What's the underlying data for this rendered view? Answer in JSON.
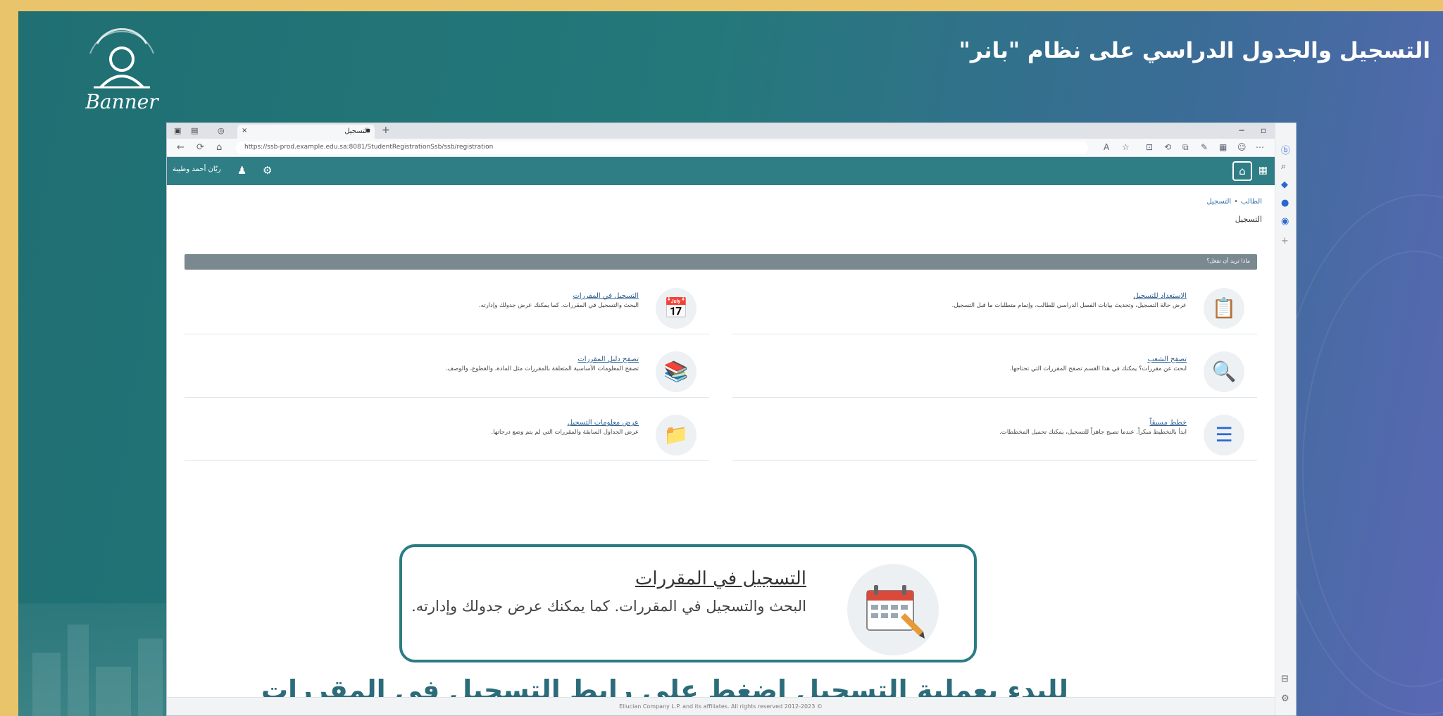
{
  "slide": {
    "title": "التسجيل والجدول الدراسي على نظام \"بانر\"",
    "logo_word": "Banner",
    "instruction": "للبدء بعملية التسجيل إضغط على رابط التسجيل في المقررات",
    "colors": {
      "frame": "#e9c46a",
      "teal": "#1f6f73",
      "accent": "#2c6c7a"
    }
  },
  "browser": {
    "tab_title": "التسجيل",
    "url": "https://ssb-prod.example.edu.sa:8081/StudentRegistrationSsb/ssb/registration",
    "window_controls": [
      "−",
      "▫",
      "×"
    ]
  },
  "app": {
    "user_name": "ريّان أحمد وطيبة",
    "breadcrumb": [
      "الطالب",
      "التسجيل"
    ],
    "page_title": "التسجيل",
    "section_label": "ماذا تريد أن تفعل؟"
  },
  "cards": [
    {
      "title": "الاستعداد للتسجيل",
      "desc": "عرض حالة التسجيل، وتحديث بيانات الفصل الدراسي للطالب، وإتمام متطلبات ما قبل التسجيل.",
      "icon": "clipboard-icon"
    },
    {
      "title": "التسجيل في المقررات",
      "desc": "البحث والتسجيل في المقررات. كما يمكنك عرض جدولك وإدارته.",
      "icon": "calendar-edit-icon"
    },
    {
      "title": "تصفح الشعب",
      "desc": "ابحث عن مقررات؟ يمكنك في هذا القسم تصفح المقررات التي تحتاجها.",
      "icon": "magnifier-icon"
    },
    {
      "title": "تصفح دليل المقررات",
      "desc": "تصفح المعلومات الأساسية المتعلقة بالمقررات مثل المادة، والقطوع، والوصف.",
      "icon": "catalog-icon"
    },
    {
      "title": "خطط مسبقاً",
      "desc": "ابدأ بالتخطيط مبكراً. عندما تصبح جاهزاً للتسجيل، يمكنك تحميل المخططات.",
      "icon": "plan-list-icon"
    },
    {
      "title": "عرض معلومات التسجيل",
      "desc": "عرض الجداول السابقة والمقررات التي لم يتم وضع درجاتها.",
      "icon": "folder-icon"
    }
  ],
  "callout": {
    "title": "التسجيل في المقررات",
    "desc": "البحث والتسجيل في المقررات. كما يمكنك عرض جدولك وإدارته."
  },
  "footer": "© 2012-2023 Ellucian Company L.P. and its affiliates. All rights reserved"
}
